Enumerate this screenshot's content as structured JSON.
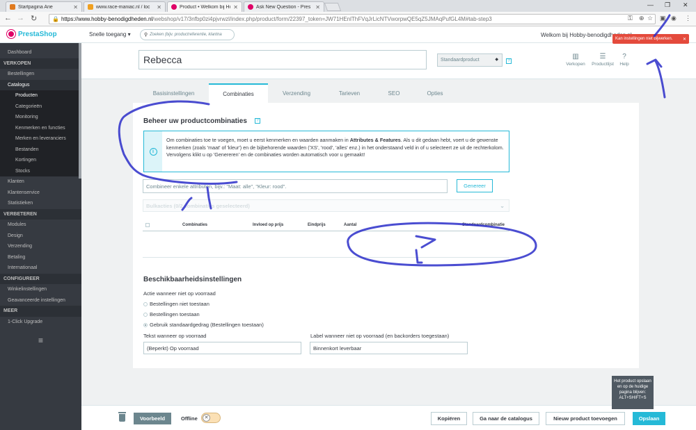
{
  "browser": {
    "tabs": [
      {
        "title": "Startpagina Arie",
        "color": "#e07a1f"
      },
      {
        "title": "www.race-maniac.nl / loc",
        "color": "#f0a020"
      },
      {
        "title": "Product • Welkom bij Ho",
        "color": "#df0067"
      },
      {
        "title": "Ask New Question - Pres",
        "color": "#df0067"
      }
    ],
    "url_host": "https://www.hobby-benodigdheden.nl",
    "url_path": "/webshop/v17/3nfbp0zi4pjvrwzl/index.php/product/form/22397_token=JW71HEnlThFVqJrLicNTVworpwQE5qZ5JMAqPufGL4M#tab-step3"
  },
  "header": {
    "brand": "PrestaShop",
    "quick_access": "Snelle toegang",
    "search_placeholder": "Zoeken (bijv. productreferentie, klantna",
    "welcome": "Welkom bij Hobby-benodigdheden.nl",
    "error_toast": "Kan instellingen niet bijwerken."
  },
  "sidebar": {
    "dashboard": "Dashboard",
    "sec_verkopen": "VERKOPEN",
    "bestellingen": "Bestellingen",
    "catalogus": "Catalogus",
    "sub": [
      "Producten",
      "Categorieën",
      "Monitoring",
      "Kenmerken en functies",
      "Merken en leveranciers",
      "Bestanden",
      "Kortingen",
      "Stocks"
    ],
    "klanten": "Klanten",
    "klantenservice": "Klantenservice",
    "statistieken": "Statistieken",
    "sec_verbeteren": "VERBETEREN",
    "modules": "Modules",
    "design": "Design",
    "verzending": "Verzending",
    "betaling": "Betaling",
    "internationaal": "Internationaal",
    "sec_configureer": "CONFIGUREER",
    "winkel": "Winkelinstellingen",
    "geavanceerd": "Geavanceerde instellingen",
    "sec_meer": "MEER",
    "upgrade": "1-Click Upgrade"
  },
  "product": {
    "name": "Rebecca",
    "type": "Standaardproduct",
    "tools": [
      "Verkopen",
      "Productlijst",
      "Help"
    ]
  },
  "tabs": [
    "Basisinstellingen",
    "Combinaties",
    "Verzending",
    "Tarieven",
    "SEO",
    "Opties"
  ],
  "combinations": {
    "title": "Beheer uw productcombinaties",
    "alert_pre": "Om combinaties toe te voegen, moet u eerst kenmerken en waarden aanmaken in ",
    "alert_bold": "Attributes & Features",
    "alert_post": ". Als u dit gedaan hebt, voert u de gewenste kenmerken (zoals 'maat' of 'kleur') en de bijbehorende waarden ('XS', 'rood', 'alles' enz.) in het onderstaand veld in of u selecteert ze uit de rechterkolom. Vervolgens klikt u op 'Genereren' en de combinaties worden automatisch voor u gemaakt!",
    "input_placeholder": "Combineer enkele attributen, bijv.: \"Maat: alle\", \"Kleur: rood\".",
    "generate": "Genereer",
    "bulk": "Bulkacties (0/2 combinaties geselecteerd)",
    "columns": [
      "Combinaties",
      "Invloed op prijs",
      "Eindprijs",
      "Aantal",
      "Standaardcombinatie"
    ]
  },
  "availability": {
    "title": "Beschikbaarheidsinstellingen",
    "action_label": "Actie wanneer niet op voorraad",
    "options": [
      "Bestellingen niet toestaan",
      "Bestellingen toestaan",
      "Gebruik standaardgedrag (Bestellingen toestaan)"
    ],
    "text_label": "Tekst wanneer op voorraad",
    "text_value": "(Beperkt) Op voorraad",
    "label_label": "Label wanneer niet op voorraad (en backorders toegestaan)",
    "label_value": "Binnenkort leverbaar"
  },
  "footer": {
    "preview": "Voorbeeld",
    "offline": "Offline",
    "copy": "Kopiëren",
    "catalog": "Ga naar de catalogus",
    "new": "Nieuw product toevoegen",
    "save": "Opslaan",
    "tooltip": [
      "Het product opslaan",
      "en op de huidige",
      "pagina blijven:",
      "ALT+SHIFT+S"
    ]
  },
  "colors": {
    "accent": "#25b9d7",
    "sidebar": "#363a41",
    "error": "#e44a3c",
    "brand_pink": "#df0067"
  }
}
